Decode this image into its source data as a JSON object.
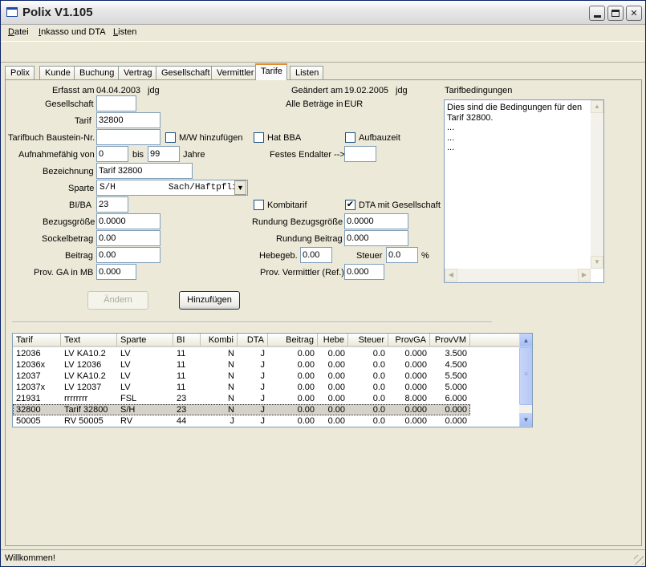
{
  "window": {
    "title": "Polix V1.105",
    "min_label": "",
    "max_label": "",
    "close_label": "✕"
  },
  "menu": {
    "items": [
      {
        "label": "Datei"
      },
      {
        "label": "Inkasso und DTA"
      },
      {
        "label": "Listen"
      }
    ]
  },
  "tabs": [
    {
      "label": "Polix"
    },
    {
      "label": "Kunde"
    },
    {
      "label": "Buchung"
    },
    {
      "label": "Vertrag"
    },
    {
      "label": "Gesellschaft"
    },
    {
      "label": "Vermittler"
    },
    {
      "label": "Tarife",
      "active": true
    },
    {
      "label": "Listen"
    }
  ],
  "form": {
    "erfasst_label": "Erfasst am",
    "erfasst_date": "04.04.2003",
    "erfasst_user": "jdg",
    "geaendert_label": "Geändert am",
    "geaendert_date": "19.02.2005",
    "geaendert_user": "jdg",
    "betraege_label": "Alle Beträge in",
    "betraege_currency": "EUR",
    "gesellschaft_label": "Gesellschaft",
    "gesellschaft_value": "",
    "tarif_label": "Tarif",
    "tarif_value": "32800",
    "baustein_label": "Tarifbuch Baustein-Nr.",
    "baustein_value": "",
    "mw_label": "M/W hinzufügen",
    "mw_checked": "",
    "bba_label": "Hat BBA",
    "bba_checked": "",
    "aufbauzeit_label": "Aufbauzeit",
    "aufbauzeit_checked": "",
    "aufnahme_label": "Aufnahmefähig von",
    "aufnahme_von": "0",
    "bis_label": "bis",
    "aufnahme_bis": "99",
    "jahre_label": "Jahre",
    "endalter_label": "Festes Endalter -->",
    "endalter_value": "",
    "bezeichnung_label": "Bezeichnung",
    "bezeichnung_value": "Tarif 32800",
    "sparte_label": "Sparte",
    "sparte_value": "S/H          Sach/Haftpflic",
    "sparte_arrow": "▼",
    "bi_label": "BI/BA",
    "bi_value": "23",
    "kombitarif_label": "Kombitarif",
    "kombitarif_checked": "",
    "dta_label": "DTA mit Gesellschaft",
    "dta_checked": "✔",
    "bezugsgroesse_label": "Bezugsgröße",
    "bezugsgroesse_value": "0.0000",
    "rundung_bezug_label": "Rundung Bezugsgröße",
    "rundung_bezug_value": "0.0000",
    "sockelbetrag_label": "Sockelbetrag",
    "sockelbetrag_value": "0.00",
    "rundung_beitrag_label": "Rundung Beitrag",
    "rundung_beitrag_value": "0.000",
    "beitrag_label": "Beitrag",
    "beitrag_value": "0.00",
    "hebegeb_label": "Hebegeb.",
    "hebegeb_value": "0.00",
    "steuer_label": "Steuer",
    "steuer_value": "0.0",
    "steuer_unit": "%",
    "provga_label": "Prov. GA in MB",
    "provga_value": "0.000",
    "provverm_label": "Prov. Vermittler (Ref.)",
    "provverm_value": "0.000",
    "tarifbedingungen_label": "Tarifbedingungen",
    "tarifbedingungen_text": "Dies sind die Bedingungen für den Tarif 32800.\n...\n...\n..."
  },
  "buttons": {
    "aendern": "Ändern",
    "hinzufuegen": "Hinzufügen"
  },
  "table": {
    "headers": [
      "Tarif",
      "Text",
      "Sparte",
      "BI",
      "Kombi",
      "DTA",
      "Beitrag",
      "Hebe",
      "Steuer",
      "ProvGA",
      "ProvVM"
    ],
    "rows": [
      [
        "12036",
        "LV KA10.2",
        "LV",
        "11",
        "N",
        "J",
        "0.00",
        "0.00",
        "0.0",
        "0.000",
        "3.500"
      ],
      [
        "12036x",
        "LV 12036",
        "LV",
        "11",
        "N",
        "J",
        "0.00",
        "0.00",
        "0.0",
        "0.000",
        "4.500"
      ],
      [
        "12037",
        "LV KA10.2",
        "LV",
        "11",
        "N",
        "J",
        "0.00",
        "0.00",
        "0.0",
        "0.000",
        "5.500"
      ],
      [
        "12037x",
        "LV 12037",
        "LV",
        "11",
        "N",
        "J",
        "0.00",
        "0.00",
        "0.0",
        "0.000",
        "5.000"
      ],
      [
        "21931",
        "rrrrrrrr",
        "FSL",
        "23",
        "N",
        "J",
        "0.00",
        "0.00",
        "0.0",
        "8.000",
        "6.000"
      ],
      [
        "32800",
        "Tarif 32800",
        "S/H",
        "23",
        "N",
        "J",
        "0.00",
        "0.00",
        "0.0",
        "0.000",
        "0.000"
      ],
      [
        "50005",
        "RV 50005",
        "RV",
        "44",
        "J",
        "J",
        "0.00",
        "0.00",
        "0.0",
        "0.000",
        "0.000"
      ]
    ],
    "selected_row": 5,
    "scroll_up": "▲",
    "scroll_down": "▼",
    "scroll_grip": "≡"
  },
  "status": {
    "text": "Willkommen!"
  }
}
